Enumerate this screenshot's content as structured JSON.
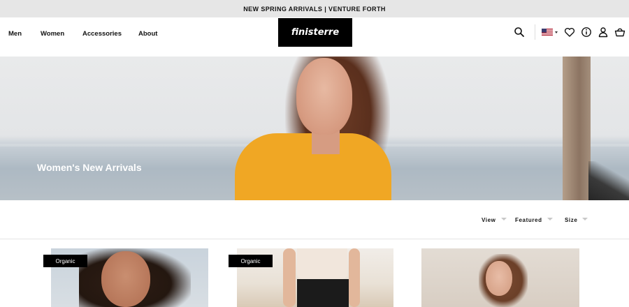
{
  "announcement": {
    "text": "NEW SPRING ARRIVALS | VENTURE FORTH"
  },
  "header": {
    "nav": [
      {
        "label": "Men"
      },
      {
        "label": "Women"
      },
      {
        "label": "Accessories"
      },
      {
        "label": "About"
      }
    ],
    "logo_text": "finisterre",
    "icons": [
      "search-icon",
      "flag-us-icon",
      "heart-icon",
      "info-icon",
      "account-icon",
      "basket-icon"
    ]
  },
  "hero": {
    "title": "Women's New Arrivals"
  },
  "filters": [
    {
      "label": "View"
    },
    {
      "label": "Featured"
    },
    {
      "label": "Size"
    }
  ],
  "products": [
    {
      "badge": "Organic"
    },
    {
      "badge": "Organic"
    },
    {
      "badge": ""
    }
  ],
  "colors": {
    "announcement_bg": "#e6e6e6",
    "logo_bg": "#000000",
    "badge_bg": "#000000",
    "sweater_accent": "#f0a724"
  }
}
